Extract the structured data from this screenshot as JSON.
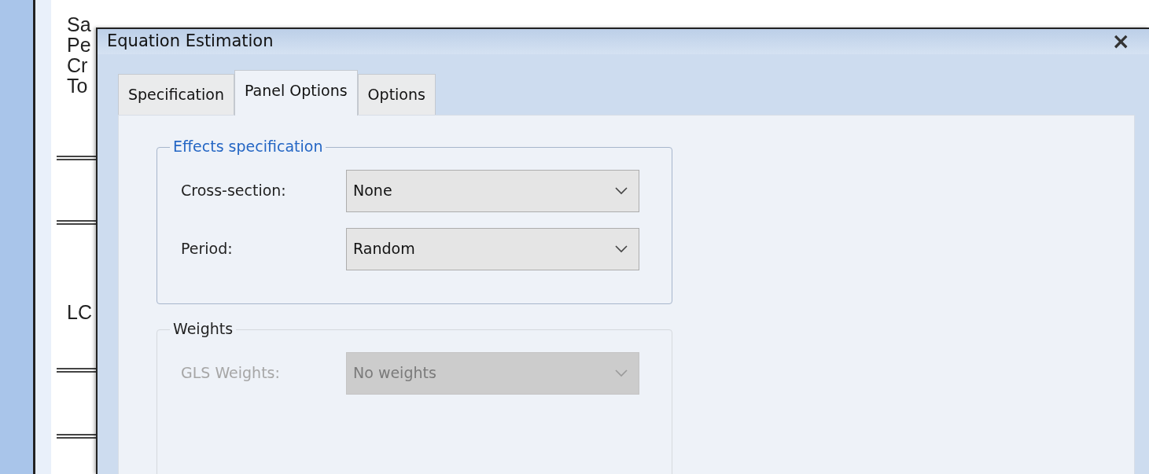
{
  "background_text": [
    "Sa",
    "Pe",
    "Cr",
    "To",
    "LC"
  ],
  "dialog": {
    "title": "Equation Estimation",
    "close": "×",
    "tabs": [
      {
        "label": "Specification",
        "selected": false
      },
      {
        "label": "Panel Options",
        "selected": true
      },
      {
        "label": "Options",
        "selected": false
      }
    ],
    "groups": [
      {
        "legend": "Effects specification",
        "focused": true,
        "fields": [
          {
            "label": "Cross-section:",
            "value": "None",
            "disabled": false
          },
          {
            "label": "Period:",
            "value": "Random",
            "disabled": false
          }
        ]
      },
      {
        "legend": "Weights",
        "focused": false,
        "fields": [
          {
            "label": "GLS Weights:",
            "value": "No weights",
            "disabled": true
          }
        ]
      }
    ]
  }
}
